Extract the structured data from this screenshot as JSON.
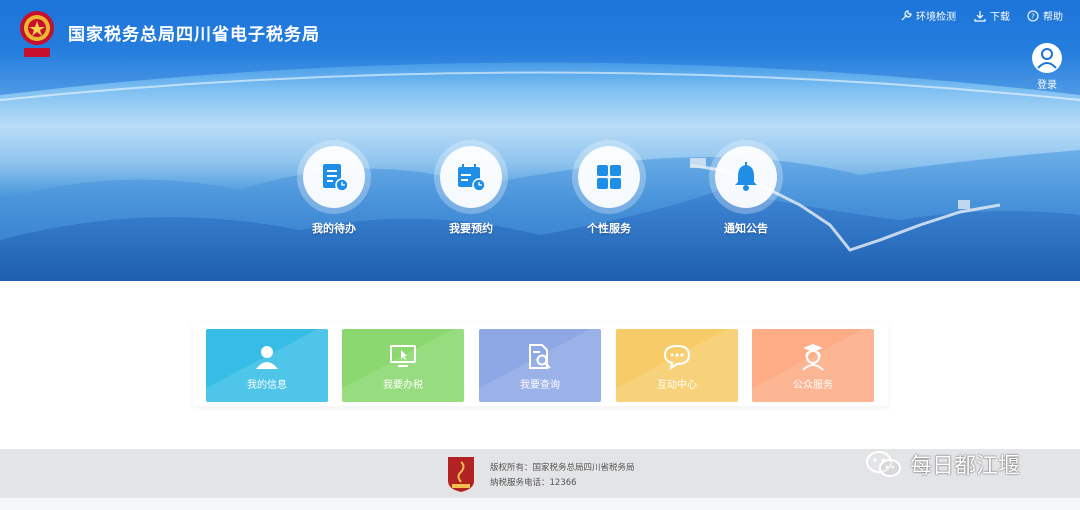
{
  "header": {
    "site_title": "国家税务总局四川省电子税务局",
    "links": {
      "env_check": "环境检测",
      "download": "下载",
      "help": "帮助"
    },
    "login_label": "登录"
  },
  "hero": {
    "items": [
      {
        "label": "我的待办",
        "icon": "todo-clock-icon"
      },
      {
        "label": "我要预约",
        "icon": "calendar-clock-icon"
      },
      {
        "label": "个性服务",
        "icon": "grid-icon"
      },
      {
        "label": "通知公告",
        "icon": "bell-icon"
      }
    ],
    "accent": "#1a73d9"
  },
  "cards": [
    {
      "label": "我的信息",
      "icon": "user-icon",
      "color": "#36bde6"
    },
    {
      "label": "我要办税",
      "icon": "monitor-cursor-icon",
      "color": "#8ad86f"
    },
    {
      "label": "我要查询",
      "icon": "document-search-icon",
      "color": "#8ea8e6"
    },
    {
      "label": "互动中心",
      "icon": "chat-bubble-icon",
      "color": "#f7cc68"
    },
    {
      "label": "公众服务",
      "icon": "service-agent-icon",
      "color": "#fdac86"
    }
  ],
  "footer": {
    "copyright": "版权所有：国家税务总局四川省税务局",
    "phone": "纳税服务电话：12366"
  },
  "watermark": {
    "text": "每日都江堰"
  }
}
